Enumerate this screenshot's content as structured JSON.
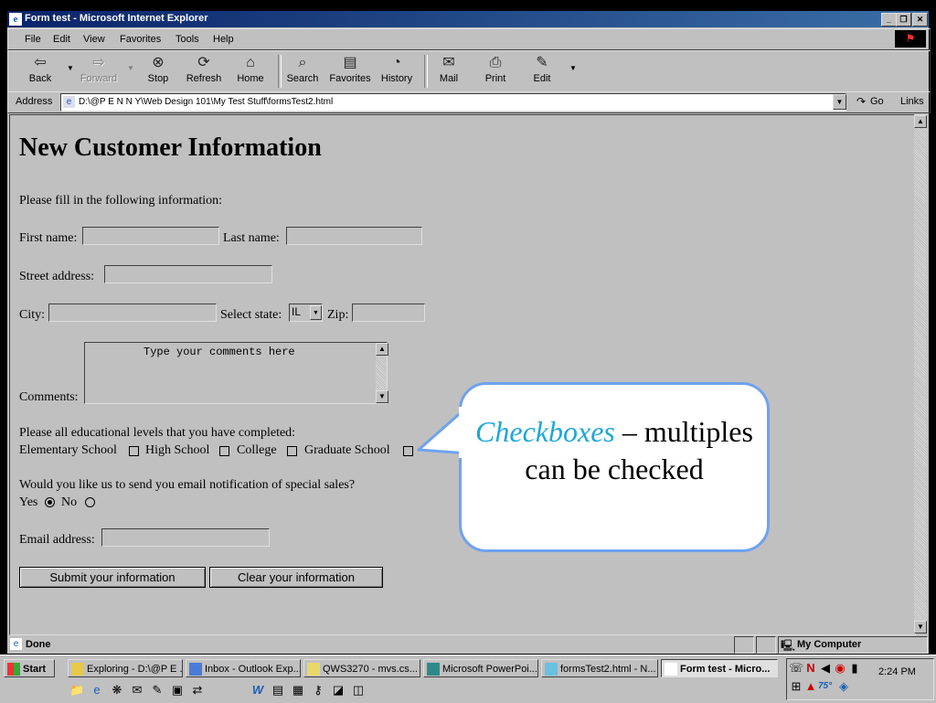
{
  "window": {
    "title": "Form test - Microsoft Internet Explorer"
  },
  "menu": [
    "File",
    "Edit",
    "View",
    "Favorites",
    "Tools",
    "Help"
  ],
  "toolbar": {
    "back": "Back",
    "forward": "Forward",
    "stop": "Stop",
    "refresh": "Refresh",
    "home": "Home",
    "search": "Search",
    "favorites": "Favorites",
    "history": "History",
    "mail": "Mail",
    "print": "Print",
    "edit": "Edit"
  },
  "address": {
    "label": "Address",
    "value": "D:\\@P E N N Y\\Web Design 101\\My Test Stuff\\formsTest2.html",
    "go": "Go",
    "links": "Links"
  },
  "form": {
    "heading": "New Customer Information",
    "intro": "Please fill in the following information:",
    "first_name_label": "First name:",
    "last_name_label": "Last name:",
    "street_label": "Street address:",
    "city_label": "City:",
    "state_label": "Select state:",
    "state_value": "IL",
    "zip_label": "Zip:",
    "comments_label": "Comments:",
    "comments_value": "Type your comments here",
    "edu_prompt": "Please all educational levels that you have completed:",
    "edu_options": [
      "Elementary School",
      "High School",
      "College",
      "Graduate School"
    ],
    "email_prompt": "Would you like us to send you email notification of special sales?",
    "yes_label": "Yes",
    "no_label": "No",
    "email_label": "Email address:",
    "submit_label": "Submit your information",
    "clear_label": "Clear your information"
  },
  "status": {
    "text": "Done",
    "zone": "My Computer"
  },
  "callout": {
    "highlight": "Checkboxes",
    "rest": " – multiples can be checked"
  },
  "taskbar": {
    "start": "Start",
    "tasks": [
      "Exploring - D:\\@P E ...",
      "Inbox - Outlook Exp...",
      "QWS3270 - mvs.cs...",
      "Microsoft PowerPoi...",
      "formsTest2.html - N...",
      "Form test - Micro..."
    ],
    "clock": "2:24 PM",
    "tray_temp": "75°"
  },
  "colors": {
    "callout_border": "#6fa2ee",
    "callout_highlight": "#1ea7d6",
    "titlebar": "#0a246a"
  }
}
